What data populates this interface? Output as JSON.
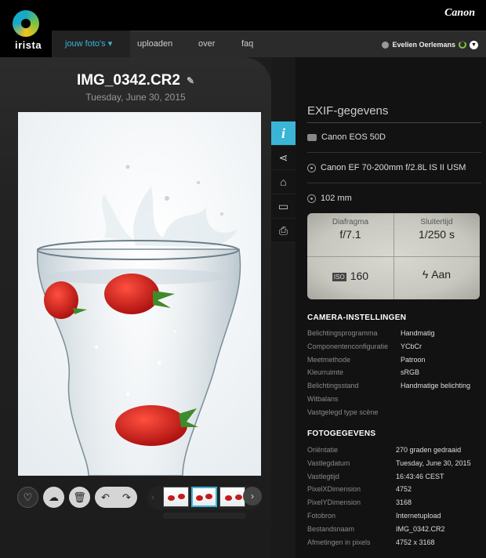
{
  "app": {
    "logo": "irista",
    "brand": "Canon"
  },
  "nav": {
    "items": [
      "jouw foto's",
      "uploaden",
      "over",
      "faq"
    ],
    "active_arrow": "▾",
    "user_name": "Evelien Oerlemans"
  },
  "photo": {
    "file_name": "IMG_0342.CR2",
    "date": "Tuesday, June 30, 2015"
  },
  "exif": {
    "title": "EXIF-gegevens",
    "camera": "Canon EOS 50D",
    "lens": "Canon EF 70-200mm f/2.8L IS II USM",
    "focal_length": "102 mm",
    "lcd": {
      "aperture_label": "Diafragma",
      "aperture_value": "f/7.1",
      "shutter_label": "Sluitertijd",
      "shutter_value": "1/250 s",
      "iso_badge": "ISO",
      "iso_value": "160",
      "flash_value": "Aan"
    }
  },
  "camera_settings": {
    "title": "CAMERA-INSTELLINGEN",
    "rows": [
      {
        "key": "Belichtingsprogramma",
        "value": "Handmatig"
      },
      {
        "key": "Componentenconfiguratie",
        "value": "YCbCr"
      },
      {
        "key": "Meetmethode",
        "value": "Patroon"
      },
      {
        "key": "Kleurruimte",
        "value": "sRGB"
      },
      {
        "key": "Belichtingsstand",
        "value": "Handmatige belichting"
      },
      {
        "key": "Witbalans",
        "value": ""
      },
      {
        "key": "Vastgelegd type scène",
        "value": ""
      }
    ]
  },
  "photo_data": {
    "title": "FOTOGEGEVENS",
    "rows": [
      {
        "key": "Oriëntatie",
        "value": "270 graden gedraaid"
      },
      {
        "key": "Vastlegdatum",
        "value": "Tuesday, June 30, 2015"
      },
      {
        "key": "Vastlegtijd",
        "value": "16:43:46 CEST"
      },
      {
        "key": "PixelXDimension",
        "value": "4752"
      },
      {
        "key": "PixelYDimension",
        "value": "3168"
      },
      {
        "key": "Fotobron",
        "value": "Internetupload"
      },
      {
        "key": "Bestandsnaam",
        "value": "IMG_0342.CR2"
      },
      {
        "key": "Afmetingen in pixels",
        "value": "4752 x 3168"
      }
    ]
  },
  "colors": {
    "accent": "#3ab5d6",
    "background": "#1a1a1a",
    "panel": "#121212"
  }
}
